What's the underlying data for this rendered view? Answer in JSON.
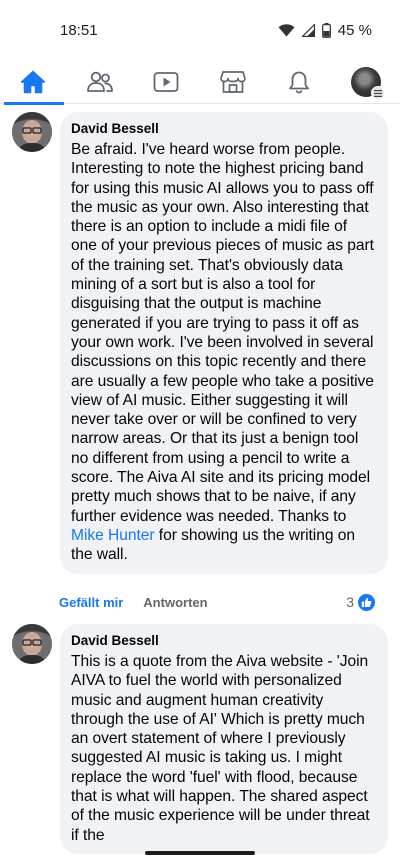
{
  "status": {
    "time": "18:51",
    "battery": "45 %"
  },
  "nav": {
    "items": [
      "home",
      "friends",
      "video",
      "marketplace",
      "notifications",
      "profile-menu"
    ],
    "active": "home"
  },
  "comments": [
    {
      "author": "David Bessell",
      "text_before_mention": "Be afraid. I've heard worse from people. Interesting to note the highest pricing band for using this music AI allows you to pass off the music as your own. Also interesting that there is an option to include a midi file of one of your previous pieces of music as part of the training set. That's obviously data mining of a sort but is also a tool for disguising that the output is machine generated if you are trying to pass it off as your own work. I've been involved in several discussions on this topic recently and there are usually a few people who take a positive view of AI music. Either suggesting it will never take over or will be confined to very narrow areas. Or that its just a benign tool no different from using a pencil to write a score. The Aiva AI site and its pricing model pretty  much shows that to be naive, if any further evidence was needed. Thanks to ",
      "mention": "Mike Hunter",
      "text_after_mention": " for showing us the writing on the wall.",
      "like_label": "Gefällt mir",
      "reply_label": "Antworten",
      "reaction_count": "3"
    },
    {
      "author": "David Bessell",
      "text": "This is a quote from the Aiva website - 'Join AIVA to fuel the world with personalized music and augment human creativity through the use of AI' Which is pretty much an overt statement of where I previously suggested AI music is taking us. I might replace the word 'fuel' with flood, because that is what will happen. The shared aspect of the music experience will be under threat if the"
    }
  ],
  "colors": {
    "accent": "#1877f2",
    "bubble": "#f0f2f5",
    "secondary_text": "#65676b"
  }
}
